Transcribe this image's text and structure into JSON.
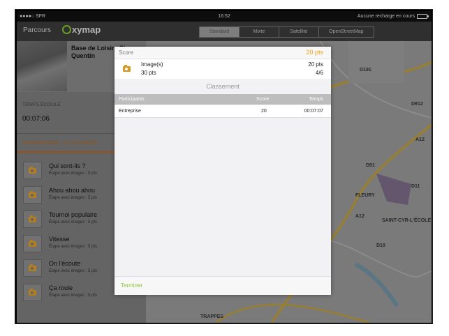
{
  "status_bar": {
    "carrier": "●●●●○ SFR",
    "time": "16:52",
    "right_text": "Aucune recharge en cours"
  },
  "nav": {
    "back_label": "Parcours",
    "logo_text": "xymap",
    "map_types": [
      "Standard",
      "Mixte",
      "Satellite",
      "OpenStreetMap"
    ],
    "active_map_type": "Standard"
  },
  "sidebar": {
    "place_name": "Base de Loisirs St Quentin",
    "time_label": "TEMPS ÉCOULÉ",
    "time_value": "00:07:06",
    "progress_label": "PROGRESSION : 20 / 30 POINTS",
    "progress_fraction": 0.667,
    "steps": [
      {
        "title": "Qui sont-ils ?",
        "subtitle": "Étape avec images : 5 pts"
      },
      {
        "title": "Ahou ahou ahou",
        "subtitle": "Étape avec images : 5 pts"
      },
      {
        "title": "Tournoi populaire",
        "subtitle": "Étape avec images : 5 pts"
      },
      {
        "title": "Vitesse",
        "subtitle": "Étape avec images : 5 pts"
      },
      {
        "title": "On l'écoute",
        "subtitle": "Étape avec images : 5 pts"
      },
      {
        "title": "Ça roule",
        "subtitle": "Étape avec images : 5 pts"
      }
    ]
  },
  "map": {
    "labels": [
      "D191",
      "D912",
      "A12",
      "FLEURY",
      "SAINT-CYR-L'ÉCOLE",
      "TRAPPES",
      "D10",
      "D91",
      "A12",
      "D11"
    ]
  },
  "modal": {
    "score_label": "Score",
    "score_value": "20 pts",
    "images_label": "Image(s)",
    "images_points": "30 pts",
    "images_score": "20 pts",
    "images_count": "4/6",
    "classement_title": "Classement",
    "table_headers": {
      "participants": "Participants",
      "score": "Score",
      "time": "Temps"
    },
    "rows": [
      {
        "participant": "Entreprise",
        "score": "20",
        "time": "00:07:07"
      }
    ],
    "footer_button": "Terminer"
  },
  "colors": {
    "accent_orange": "#f2a11a",
    "accent_green": "#8cc43a",
    "progress_bar": "#c0601a"
  }
}
